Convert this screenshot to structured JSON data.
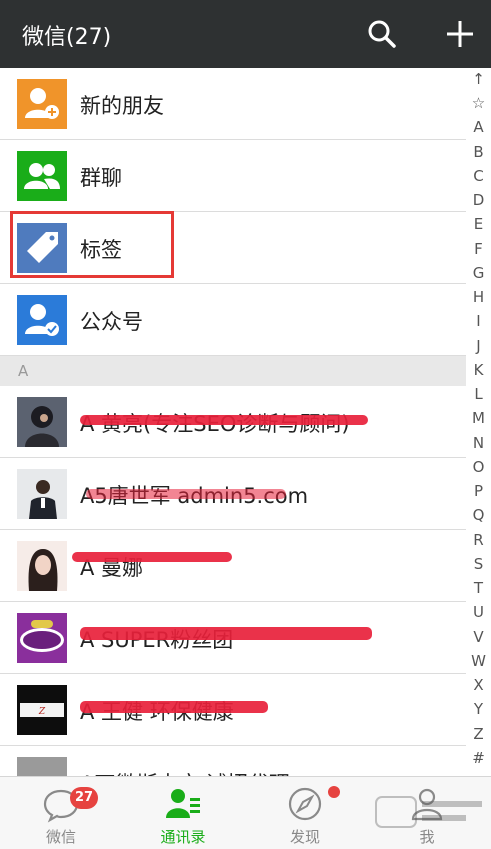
{
  "header": {
    "title": "微信(27)",
    "search_icon": "search-icon",
    "add_icon": "plus-icon"
  },
  "special_rows": [
    {
      "label": "新的朋友",
      "icon": "add-friend-icon",
      "color": "#f0942a"
    },
    {
      "label": "群聊",
      "icon": "group-chat-icon",
      "color": "#1aad19"
    },
    {
      "label": "标签",
      "icon": "tag-icon",
      "color": "#4f7bbe"
    },
    {
      "label": "公众号",
      "icon": "official-account-icon",
      "color": "#2b7bd9"
    }
  ],
  "section": {
    "letter": "A"
  },
  "contacts": [
    {
      "label": "A 黄亮(专注SEO诊断与顾问)",
      "avatar": "avatar-person-dark"
    },
    {
      "label": "A5唐世军 admin5.com",
      "avatar": "avatar-man-suit"
    },
    {
      "label": "A 曼娜",
      "avatar": "avatar-woman"
    },
    {
      "label": "A SUPER粉丝团",
      "avatar": "avatar-super-team-logo"
    },
    {
      "label": "A 王健 环保健康",
      "avatar": "avatar-brand-logo"
    },
    {
      "label": "A万微斯内衣 诚招代理",
      "avatar": "avatar-photo"
    }
  ],
  "index_bar": [
    "↑",
    "☆",
    "A",
    "B",
    "C",
    "D",
    "E",
    "F",
    "G",
    "H",
    "I",
    "J",
    "K",
    "L",
    "M",
    "N",
    "O",
    "P",
    "Q",
    "R",
    "S",
    "T",
    "U",
    "V",
    "W",
    "X",
    "Y",
    "Z",
    "#"
  ],
  "tabs": [
    {
      "label": "微信",
      "icon": "chat-bubble-icon",
      "badge": "27",
      "active": false
    },
    {
      "label": "通讯录",
      "icon": "contacts-icon",
      "active": true
    },
    {
      "label": "发现",
      "icon": "compass-icon",
      "dot": true,
      "active": false
    },
    {
      "label": "我",
      "icon": "person-icon",
      "active": false
    }
  ],
  "colors": {
    "header_bg": "#2e3132",
    "accent_green": "#1aad19",
    "highlight_red": "#e53935",
    "badge_red": "#e64340",
    "redaction_red": "#e8213b"
  }
}
